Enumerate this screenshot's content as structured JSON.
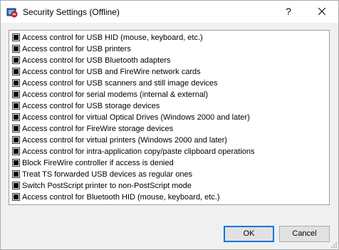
{
  "window": {
    "title": "Security Settings (Offline)",
    "help_label": "?"
  },
  "options": [
    {
      "label": "Access control for USB HID (mouse, keyboard, etc.)",
      "state": "indeterminate"
    },
    {
      "label": "Access control for USB printers",
      "state": "indeterminate"
    },
    {
      "label": "Access control for USB Bluetooth adapters",
      "state": "indeterminate"
    },
    {
      "label": "Access control for USB and FireWire network cards",
      "state": "indeterminate"
    },
    {
      "label": "Access control for USB scanners and still image devices",
      "state": "indeterminate"
    },
    {
      "label": "Access control for serial modems (internal & external)",
      "state": "indeterminate"
    },
    {
      "label": "Access control for USB storage devices",
      "state": "indeterminate"
    },
    {
      "label": "Access control for virtual Optical Drives (Windows 2000 and later)",
      "state": "indeterminate"
    },
    {
      "label": "Access control for FireWire storage devices",
      "state": "indeterminate"
    },
    {
      "label": "Access control for virtual printers (Windows 2000 and later)",
      "state": "indeterminate"
    },
    {
      "label": "Access control for intra-application copy/paste clipboard operations",
      "state": "indeterminate"
    },
    {
      "label": "Block FireWire controller if access is denied",
      "state": "indeterminate"
    },
    {
      "label": "Treat TS forwarded USB devices as regular ones",
      "state": "indeterminate"
    },
    {
      "label": "Switch PostScript printer to non-PostScript mode",
      "state": "indeterminate"
    },
    {
      "label": "Access control for Bluetooth HID (mouse, keyboard, etc.)",
      "state": "indeterminate"
    }
  ],
  "buttons": {
    "ok_label": "OK",
    "cancel_label": "Cancel"
  },
  "colors": {
    "focus_border": "#0078d7",
    "dialog_bg": "#f0f0f0",
    "list_bg": "#ffffff"
  },
  "icons": {
    "app": "security-shield-icon",
    "close": "close-icon",
    "grip": "resize-grip-icon"
  }
}
